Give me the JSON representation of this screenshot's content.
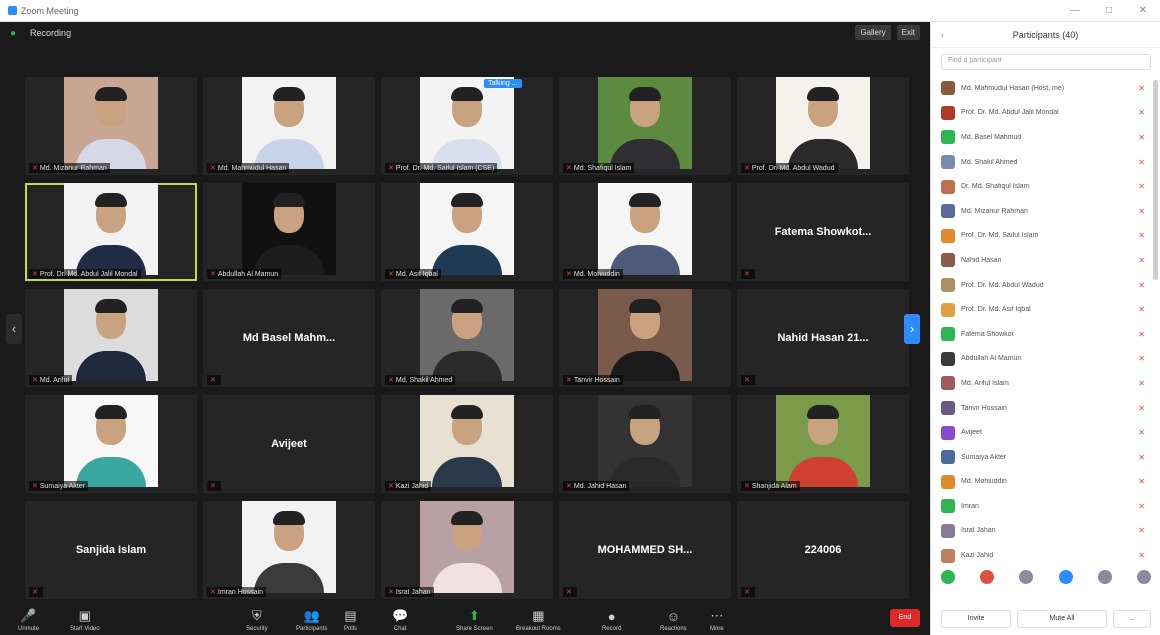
{
  "window": {
    "title": "Zoom Meeting",
    "ctrl_min": "—",
    "ctrl_max": "□",
    "ctrl_close": "✕"
  },
  "meeting": {
    "view_label": "Recording",
    "topbar_right": [
      "Gallery",
      "Exit"
    ],
    "speaking_badge": "Talking ...",
    "tiles": [
      {
        "name": "Md. Mizanur Rahman",
        "type": "photo",
        "bg": "#c9a593",
        "shirt": "#d6d8e8"
      },
      {
        "name": "Md. Mahmudul Hasan",
        "type": "photo",
        "bg": "#f2f2f2",
        "shirt": "#c7d3e8"
      },
      {
        "name": "Prof. Dr. Md. Saiful Islam (CSE)",
        "type": "photo",
        "bg": "#f4f4f4",
        "shirt": "#d8e0f0"
      },
      {
        "name": "Md. Shafiqul Islam",
        "type": "photo",
        "bg": "#5c8a3f",
        "shirt": "#2e2e33"
      },
      {
        "name": "Prof. Dr. Md. Abdul Wadud",
        "type": "photo",
        "bg": "#f5f2ee",
        "shirt": "#2a2a2a"
      },
      {
        "name": "Prof. Dr. Md. Abdul Jalil Mondal",
        "type": "photo",
        "bg": "#f2f2f2",
        "shirt": "#1f2c44",
        "active": true
      },
      {
        "name": "Abdullah Al Mamun",
        "type": "photo",
        "bg": "#111111",
        "shirt": "#1d1d1d"
      },
      {
        "name": "Md. Asif Iqbal",
        "type": "photo",
        "bg": "#f5f5f5",
        "shirt": "#1f3a55"
      },
      {
        "name": "Md. Mohiuddin",
        "type": "photo",
        "bg": "#f5f5f5",
        "shirt": "#4d5a7a"
      },
      {
        "name": "Fatema Showkat",
        "display": "Fatema Showkot...",
        "type": "text"
      },
      {
        "name": "Md. Ariful",
        "type": "photo",
        "bg": "#dcdcdc",
        "shirt": "#20283c"
      },
      {
        "name": "Md. Basel Mahm",
        "display": "Md Basel Mahm...",
        "type": "text"
      },
      {
        "name": "Md. Shakil Ahmed",
        "type": "photo",
        "bg": "#6a6a6a",
        "shirt": "#2b2b2b"
      },
      {
        "name": "Tanvir Hossain",
        "type": "photo",
        "bg": "#7a5a4a",
        "shirt": "#1a1a1a"
      },
      {
        "name": "Nahid Hasan",
        "display": "Nahid Hasan 21...",
        "type": "text"
      },
      {
        "name": "Sumaiya Akter",
        "type": "photo",
        "bg": "#f7f7f7",
        "shirt": "#3aa6a0"
      },
      {
        "name": "Avijeet",
        "display": "Avijeet",
        "type": "text"
      },
      {
        "name": "Kazi Jahid",
        "type": "photo",
        "bg": "#e8e0d0",
        "shirt": "#2a3a4a"
      },
      {
        "name": "Md. Jahid Hasan",
        "type": "photo",
        "bg": "#333333",
        "shirt": "#2a2a2a"
      },
      {
        "name": "Shanjida Alam",
        "type": "photo",
        "bg": "#7a9c4a",
        "shirt": "#d04030"
      },
      {
        "name": "Sanjida Islam",
        "display": "Sanjida Islam",
        "type": "text"
      },
      {
        "name": "Imran Hossain",
        "type": "photo",
        "bg": "#f2f2f2",
        "shirt": "#3b3b3b"
      },
      {
        "name": "Israt Jahan",
        "type": "photo",
        "bg": "#b8a0a4",
        "shirt": "#f2e0e0"
      },
      {
        "name": "Mohammed Shakib",
        "display": "MOHAMMED SH...",
        "type": "text"
      },
      {
        "name": "224006",
        "display": "224006",
        "type": "text"
      }
    ]
  },
  "toolbar": {
    "items": [
      "Unmute",
      "Start Video",
      "Security",
      "Participants",
      "Polls",
      "Chat",
      "Share Screen",
      "Breakout Rooms",
      "Record",
      "Reactions",
      "More"
    ],
    "end": "End"
  },
  "panel": {
    "title": "Participants (40)",
    "search_placeholder": "Find a participant",
    "participants": [
      {
        "name": "Md. Mahmudul Hasan (Host, me)",
        "color": "#8a5a3a"
      },
      {
        "name": "Prof. Dr. Md. Abdul Jalil Mondal",
        "color": "#b03a2a"
      },
      {
        "name": "Md. Basel Mahmud",
        "color": "#2db552"
      },
      {
        "name": "Md. Shakil Ahmed",
        "color": "#7a8ab0"
      },
      {
        "name": "Dr. Md. Shafiqul Islam",
        "color": "#c07050"
      },
      {
        "name": "Md. Mizanur Rahman",
        "color": "#5a6a9a"
      },
      {
        "name": "Prof. Dr. Md. Saiful Islam",
        "color": "#e08a2a"
      },
      {
        "name": "Nahid Hasan",
        "color": "#8a5a4a"
      },
      {
        "name": "Prof. Dr. Md. Abdul Wadud",
        "color": "#b09060"
      },
      {
        "name": "Prof. Dr. Md. Asif Iqbal",
        "color": "#e0a040"
      },
      {
        "name": "Fatema Showkot",
        "color": "#2db552"
      },
      {
        "name": "Abdullah Al Mamun",
        "color": "#3a3a3a"
      },
      {
        "name": "Md. Ariful Islam",
        "color": "#a05a5a"
      },
      {
        "name": "Tanvir Hossain",
        "color": "#6a5a8a"
      },
      {
        "name": "Avijeet",
        "color": "#8a4ad0"
      },
      {
        "name": "Sumaiya Akter",
        "color": "#4a6a9a"
      },
      {
        "name": "Md. Mohiuddin",
        "color": "#e08a2a"
      },
      {
        "name": "Imran",
        "color": "#2db552"
      },
      {
        "name": "Israt Jahan",
        "color": "#8a7a9a"
      },
      {
        "name": "Kazi Jahid",
        "color": "#c08060"
      }
    ],
    "reaction_colors": [
      "#2db552",
      "#e05040",
      "#8a8aa0",
      "#2d8cff",
      "#8a8aa0"
    ],
    "invite": "Invite",
    "mute_all": "Mute All",
    "more": "..."
  }
}
